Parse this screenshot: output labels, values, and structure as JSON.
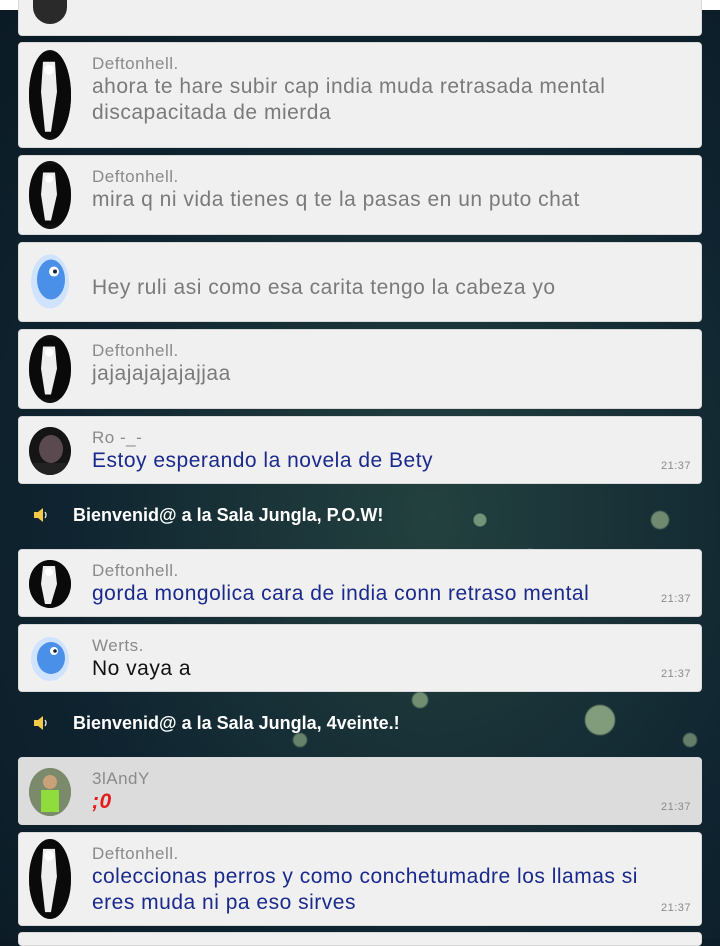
{
  "messages": [
    {
      "user": "Deftonhell.",
      "text": "ahora te hare subir cap india muda retrasada mental discapacitada de mierda",
      "time": "",
      "avatar": "dark-figure-avatar"
    },
    {
      "user": "Deftonhell.",
      "text": "mira q ni vida tienes q te la pasas en un puto chat",
      "time": "",
      "avatar": "dark-figure-avatar"
    },
    {
      "user": "",
      "text": "Hey ruli asi como esa carita tengo la cabeza yo",
      "time": "",
      "avatar": "blue-bird-avatar"
    },
    {
      "user": "Deftonhell.",
      "text": "jajajajajajajjaa",
      "time": "",
      "avatar": "dark-figure-avatar"
    },
    {
      "user": "Ro -_-",
      "text": "Estoy esperando la novela de Bety",
      "time": "21:37",
      "avatar": "dark-photo-avatar"
    },
    {
      "user": "Deftonhell.",
      "text": "gorda mongolica cara de india conn retraso mental",
      "time": "21:37",
      "avatar": "dark-figure-avatar"
    },
    {
      "user": "Werts.",
      "text": "No vaya a",
      "time": "21:37",
      "avatar": "blue-bird-avatar"
    },
    {
      "user": "3lAndY",
      "text": ";0",
      "time": "21:37",
      "avatar": "person-photo-avatar"
    },
    {
      "user": "Deftonhell.",
      "text": "coleccionas perros y como conchetumadre los llamas si eres muda ni pa eso sirves",
      "time": "21:37",
      "avatar": "dark-figure-avatar"
    }
  ],
  "system": [
    {
      "text": "Bienvenid@ a la Sala Jungla, P.O.W!",
      "icon": "speaker-icon"
    },
    {
      "text": "Bienvenid@ a la Sala Jungla, 4veinte.!",
      "icon": "speaker-icon"
    }
  ],
  "colors": {
    "blue_text": "#1a2a8c",
    "red_text": "#e51b1b",
    "bubble": "#f0f0f0"
  }
}
